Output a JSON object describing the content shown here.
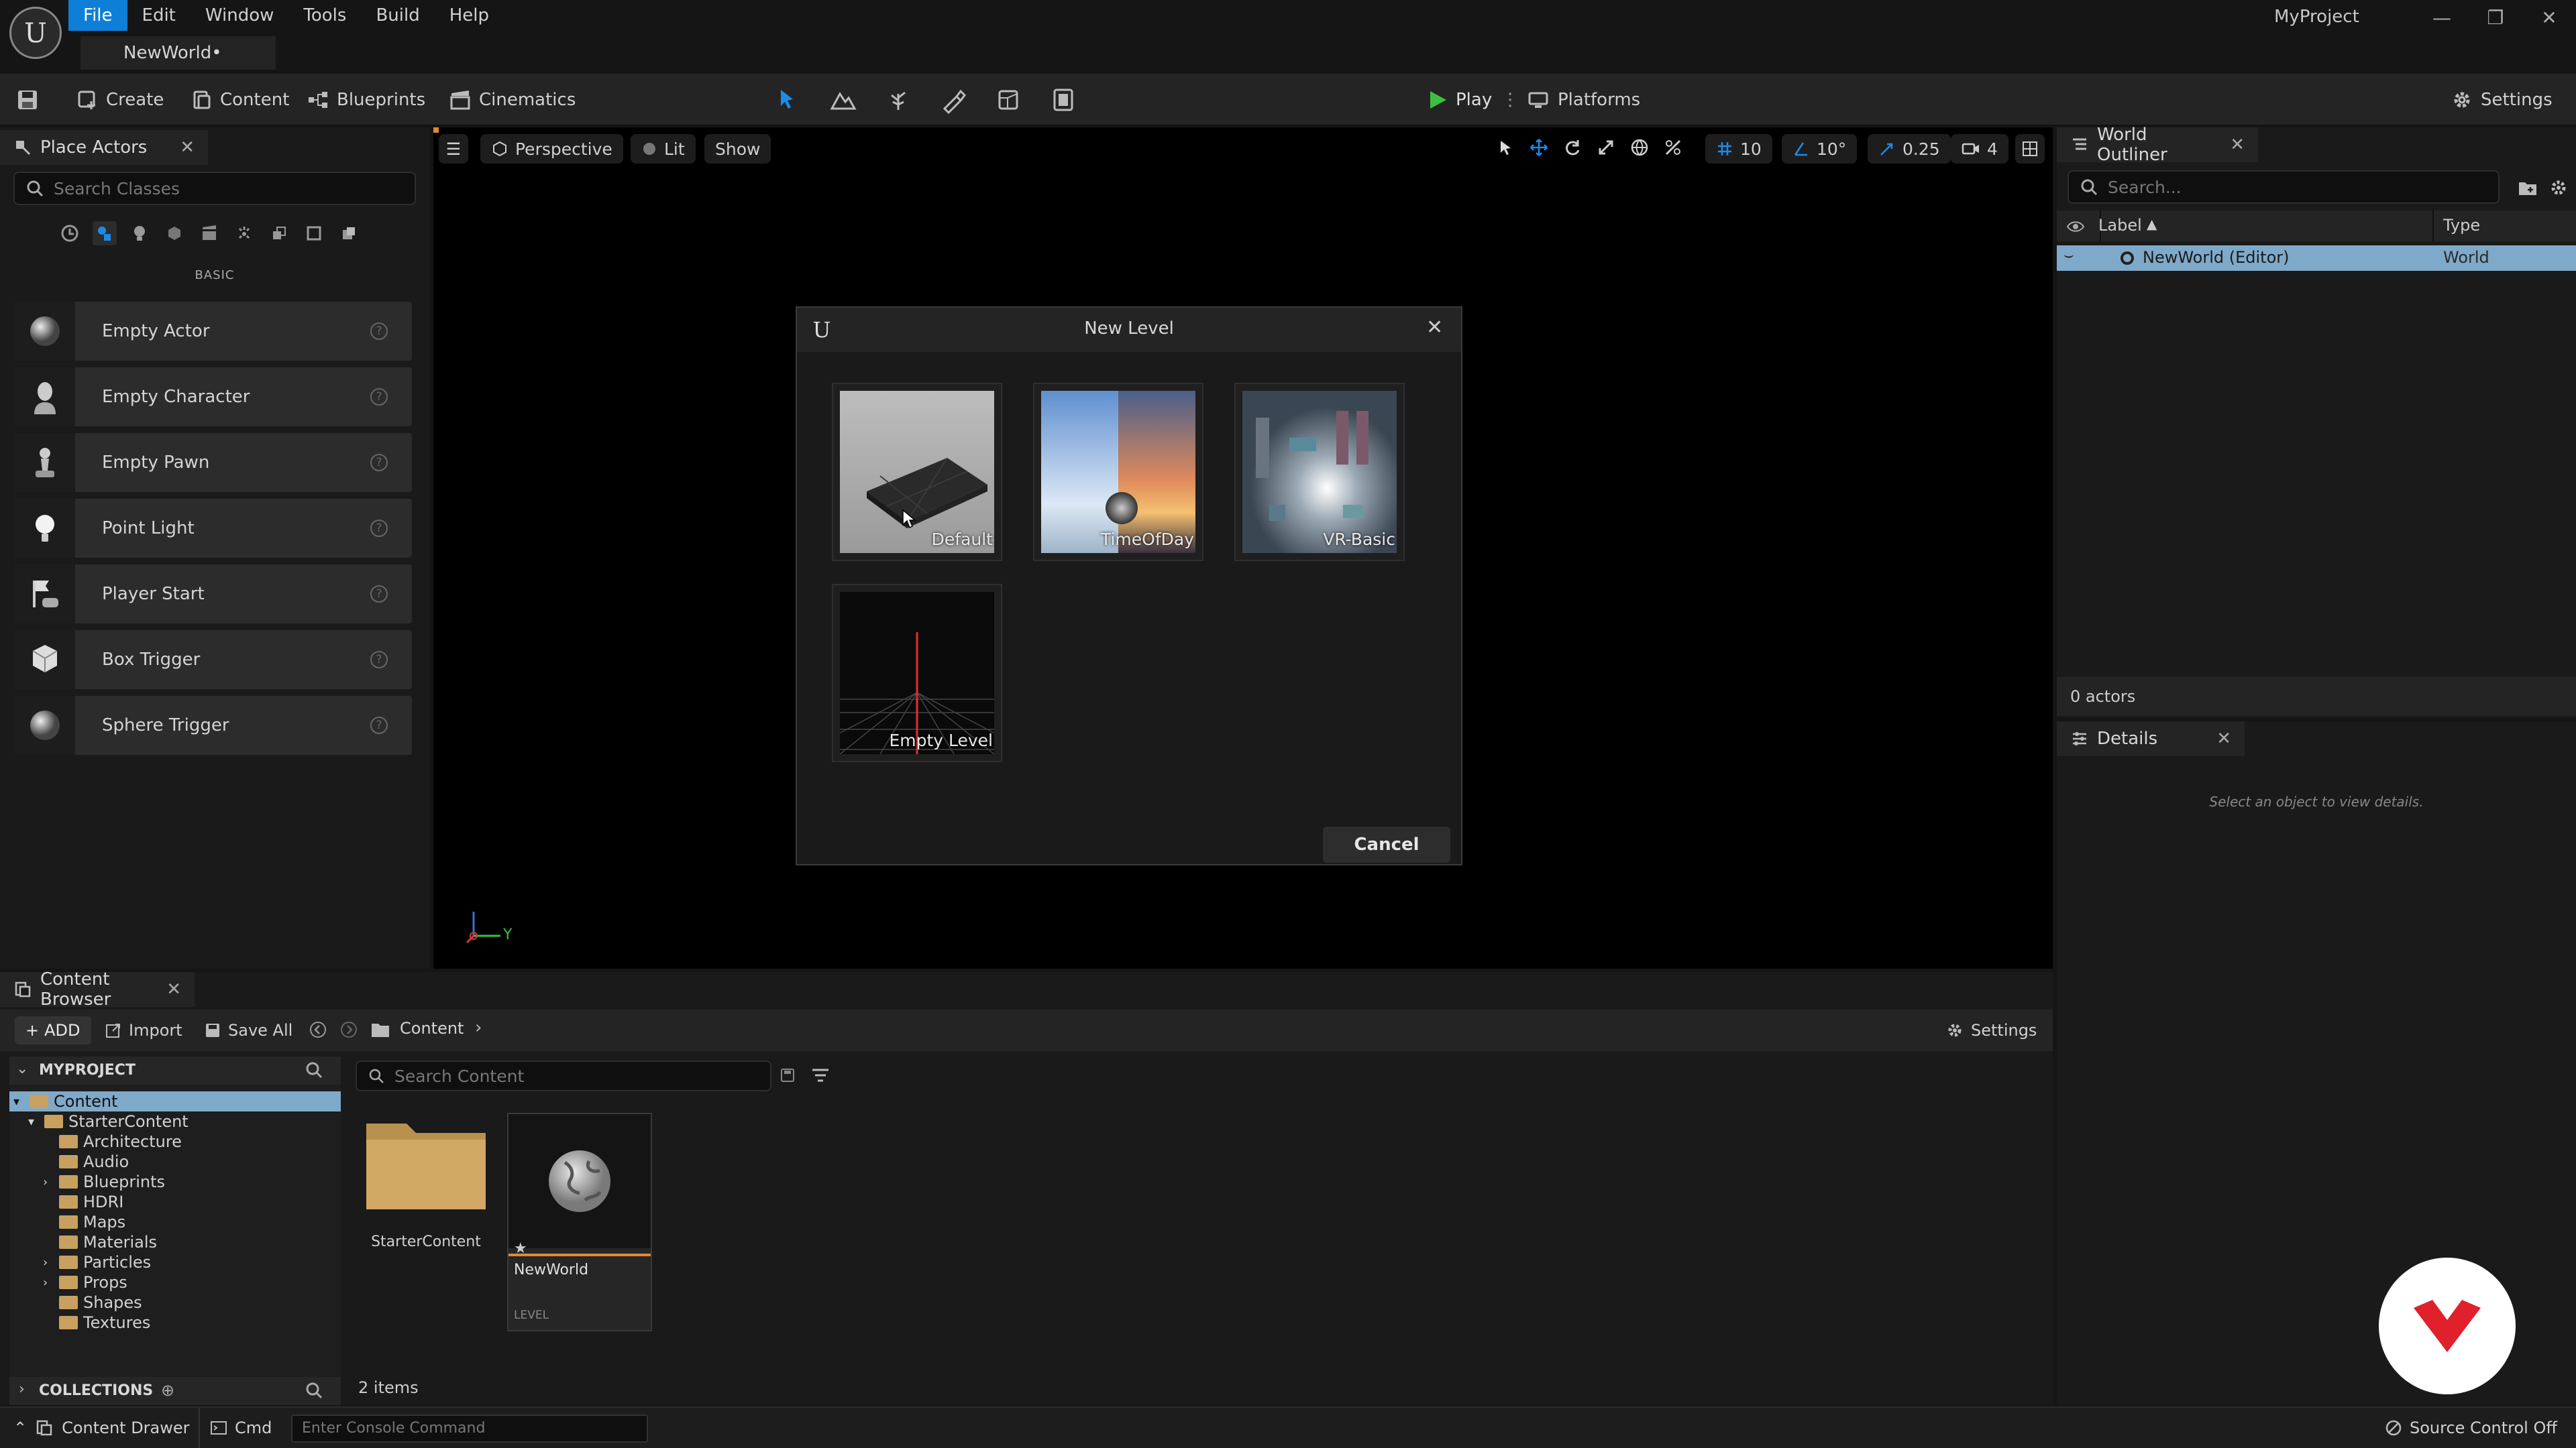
{
  "app": {
    "project_name": "MyProject",
    "document_tab": "NewWorld•"
  },
  "menu": [
    "File",
    "Edit",
    "Window",
    "Tools",
    "Build",
    "Help"
  ],
  "toolbar": {
    "create": "Create",
    "content": "Content",
    "blueprints": "Blueprints",
    "cinematics": "Cinematics",
    "play": "Play",
    "platforms": "Platforms",
    "settings": "Settings"
  },
  "place_actors": {
    "tab_title": "Place Actors",
    "search_placeholder": "Search Classes",
    "category": "BASIC",
    "items": [
      {
        "label": "Empty Actor",
        "icon": "sphere-icon"
      },
      {
        "label": "Empty Character",
        "icon": "character-icon"
      },
      {
        "label": "Empty Pawn",
        "icon": "pawn-icon"
      },
      {
        "label": "Point Light",
        "icon": "light-bulb-icon"
      },
      {
        "label": "Player Start",
        "icon": "player-start-icon"
      },
      {
        "label": "Box Trigger",
        "icon": "box-icon"
      },
      {
        "label": "Sphere Trigger",
        "icon": "sphere-icon"
      }
    ]
  },
  "viewport": {
    "perspective": "Perspective",
    "lit": "Lit",
    "show": "Show",
    "grid_snap": "10",
    "rotation_snap": "10°",
    "scale_snap": "0.25",
    "camera_speed": "4",
    "axis_label": "Y"
  },
  "new_level_dialog": {
    "title": "New Level",
    "templates": [
      "Default",
      "TimeOfDay",
      "VR-Basic",
      "Empty Level"
    ],
    "cancel": "Cancel"
  },
  "world_outliner": {
    "tab_title": "World Outliner",
    "search_placeholder": "Search...",
    "col_label": "Label",
    "col_type": "Type",
    "rows": [
      {
        "label": "NewWorld (Editor)",
        "type": "World"
      }
    ],
    "actor_count": "0 actors"
  },
  "details": {
    "tab_title": "Details",
    "empty_message": "Select an object to view details."
  },
  "content_browser": {
    "tab_title": "Content Browser",
    "add": "ADD",
    "import": "Import",
    "save_all": "Save All",
    "path": "Content",
    "settings": "Settings",
    "project_header": "MYPROJECT",
    "search_placeholder": "Search Content",
    "tree": [
      {
        "label": "Content",
        "depth": 0,
        "expanded": true,
        "selected": true
      },
      {
        "label": "StarterContent",
        "depth": 1,
        "expanded": true
      },
      {
        "label": "Architecture",
        "depth": 2
      },
      {
        "label": "Audio",
        "depth": 2
      },
      {
        "label": "Blueprints",
        "depth": 2,
        "collapsed": true
      },
      {
        "label": "HDRI",
        "depth": 2
      },
      {
        "label": "Maps",
        "depth": 2
      },
      {
        "label": "Materials",
        "depth": 2
      },
      {
        "label": "Particles",
        "depth": 2,
        "collapsed": true
      },
      {
        "label": "Props",
        "depth": 2,
        "collapsed": true
      },
      {
        "label": "Shapes",
        "depth": 2
      },
      {
        "label": "Textures",
        "depth": 2
      }
    ],
    "collections": "COLLECTIONS",
    "assets": [
      {
        "label": "StarterContent",
        "kind": ""
      },
      {
        "label": "NewWorld",
        "kind": "LEVEL"
      }
    ],
    "item_count": "2 items"
  },
  "status_bar": {
    "content_drawer": "Content Drawer",
    "cmd": "Cmd",
    "console_placeholder": "Enter Console Command",
    "source_control": "Source Control Off"
  },
  "colors": {
    "accent_blue": "#0e7fd6",
    "play_green": "#3fbf3f",
    "selection_blue": "#7fa9c9",
    "level_orange": "#e08a2c",
    "watermark_red": "#e0202a"
  }
}
